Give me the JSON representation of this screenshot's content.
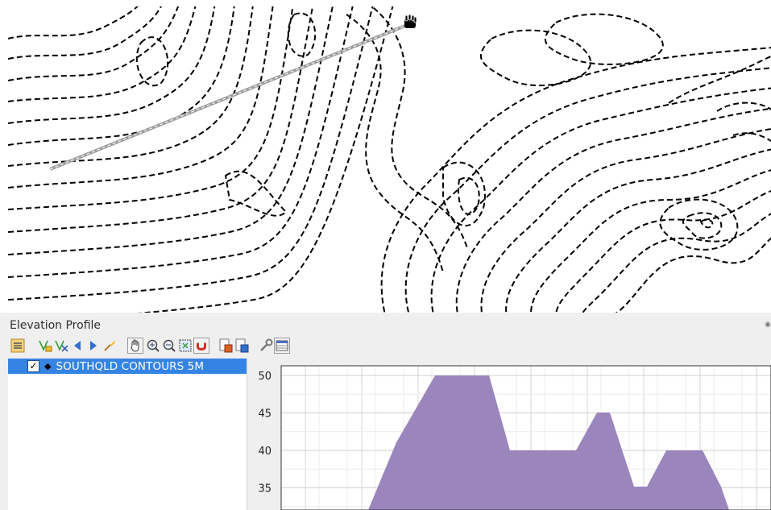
{
  "map": {
    "cursor_icon": "hand-grab-icon",
    "profile_line_color": "#9a9a9a",
    "contour_color": "#000000"
  },
  "panel": {
    "title": "Elevation Profile",
    "toolbar": [
      {
        "name": "layer-manager-icon"
      },
      {
        "name": "add-layer-icon"
      },
      {
        "name": "remove-layer-icon"
      },
      {
        "name": "previous-icon"
      },
      {
        "name": "next-icon"
      },
      {
        "name": "clear-icon"
      },
      {
        "name": "pan-icon"
      },
      {
        "name": "zoom-in-icon"
      },
      {
        "name": "zoom-out-icon"
      },
      {
        "name": "zoom-full-icon"
      },
      {
        "name": "snap-icon"
      },
      {
        "name": "export-image-icon"
      },
      {
        "name": "export-data-icon"
      },
      {
        "name": "settings-icon"
      },
      {
        "name": "table-icon"
      }
    ],
    "layers": [
      {
        "label": "SOUTHQLD CONTOURS 5M",
        "checked": true,
        "selected": true
      }
    ]
  },
  "chart_data": {
    "type": "area",
    "y_ticks": [
      "50",
      "45",
      "40",
      "35"
    ],
    "fill_color": "#9a85bc",
    "grid": true
  }
}
